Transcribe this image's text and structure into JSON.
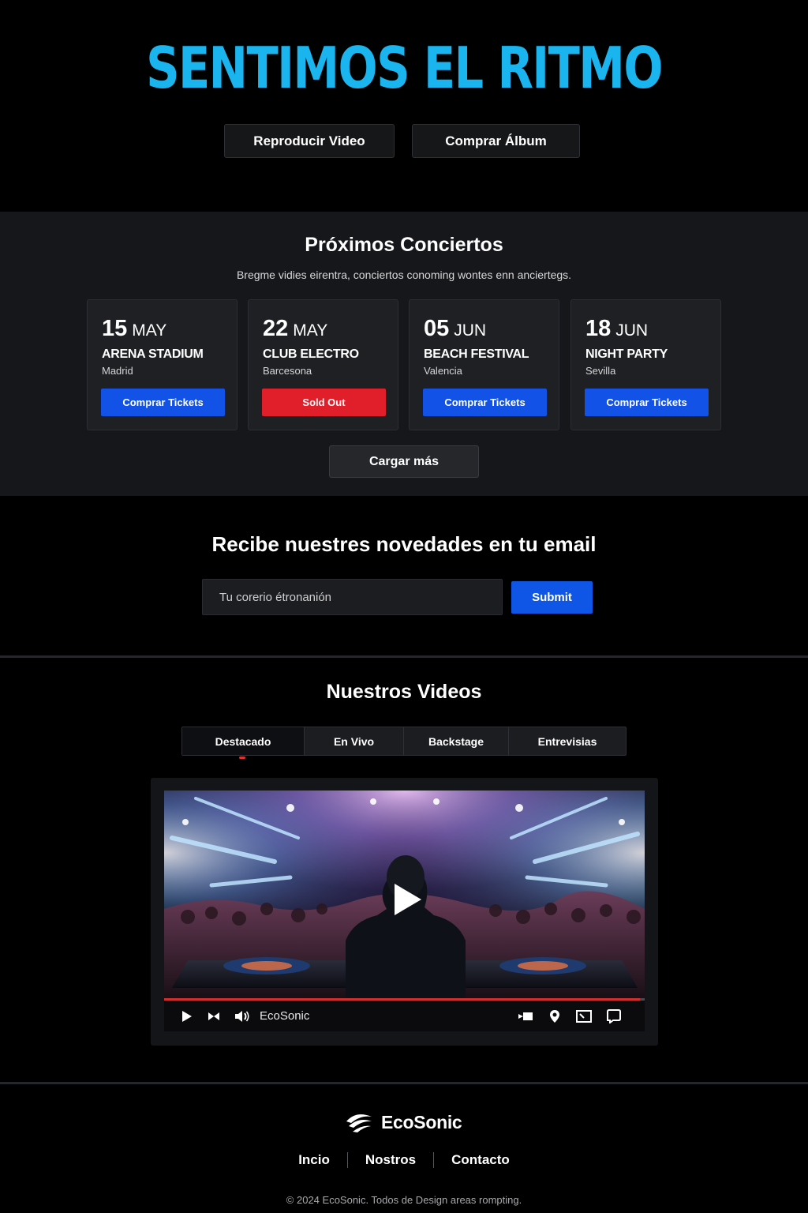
{
  "hero": {
    "title": "SENTIMOS EL RITMO",
    "play_button": "Reproducir Video",
    "album_button": "Comprar Álbum",
    "accent_color": "#1ab4ee"
  },
  "concerts": {
    "title": "Próximos Conciertos",
    "subtitle": "Bregme vidies eirentra, conciertos conoming wontes enn anciertegs.",
    "items": [
      {
        "day": "15",
        "month": "MAY",
        "venue": "ARENA STADIUM",
        "city": "Madrid",
        "button": "Comprar Tickets",
        "status": "available"
      },
      {
        "day": "22",
        "month": "MAY",
        "venue": "CLUB ELECTRO",
        "city": "Barcesona",
        "button": "Sold Out",
        "status": "sold-out"
      },
      {
        "day": "05",
        "month": "JUN",
        "venue": "BEACH FESTIVAL",
        "city": "Valencia",
        "button": "Comprar Tickets",
        "status": "available"
      },
      {
        "day": "18",
        "month": "JUN",
        "venue": "NIGHT PARTY",
        "city": "Sevilla",
        "button": "Comprar Tickets",
        "status": "available"
      }
    ],
    "load_more": "Cargar más",
    "colors": {
      "available": "#1352e6",
      "sold_out": "#e11f2a"
    }
  },
  "newsletter": {
    "title": "Recibe nuestres novedades en tu email",
    "email_placeholder": "Tu corerio étronanión",
    "submit": "Submit"
  },
  "videos": {
    "title": "Nuestros Videos",
    "tabs": [
      "Destacado",
      "En Vivo",
      "Backstage",
      "Entrevisias"
    ],
    "active_tab": "Destacado",
    "player": {
      "channel": "EcoSonic",
      "progress": 0.99,
      "controls": [
        "play-icon",
        "skip-icon",
        "volume-icon",
        "camera-icon",
        "location-pin-icon",
        "screen-icon",
        "fullscreen-icon"
      ]
    }
  },
  "footer": {
    "brand": "EcoSonic",
    "links": [
      "Incio",
      "Nostros",
      "Contacto"
    ],
    "copyright": "© 2024 EcoSonic. Todos de Design areas rompting."
  }
}
